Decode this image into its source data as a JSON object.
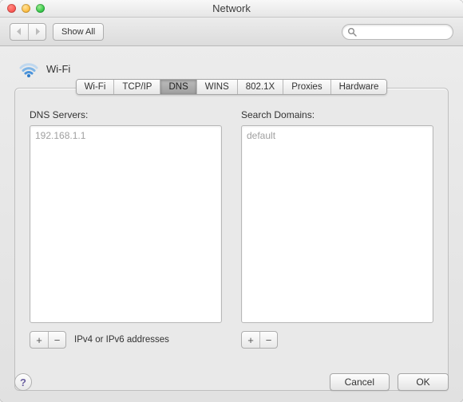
{
  "window": {
    "title": "Network"
  },
  "toolbar": {
    "show_all": "Show All",
    "search_placeholder": ""
  },
  "section": {
    "title": "Wi-Fi"
  },
  "tabs": [
    "Wi-Fi",
    "TCP/IP",
    "DNS",
    "WINS",
    "802.1X",
    "Proxies",
    "Hardware"
  ],
  "active_tab_index": 2,
  "dns": {
    "servers_label": "DNS Servers:",
    "domains_label": "Search Domains:",
    "servers": [
      "192.168.1.1"
    ],
    "domains": [
      "default"
    ],
    "hint": "IPv4 or IPv6 addresses"
  },
  "buttons": {
    "cancel": "Cancel",
    "ok": "OK"
  }
}
